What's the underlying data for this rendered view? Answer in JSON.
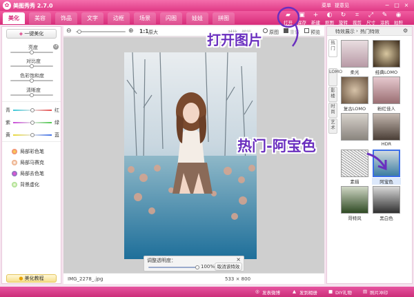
{
  "app": {
    "title": "美图秀秀 2.7.0"
  },
  "top_links": [
    "菜单",
    "提意见"
  ],
  "tabs": [
    "美化",
    "美容",
    "饰品",
    "文字",
    "边框",
    "场景",
    "闪图",
    "娃娃",
    "拼图"
  ],
  "tools": [
    "打开",
    "保存",
    "新建",
    "抠图",
    "旋转",
    "裁剪",
    "尺寸",
    "涂鸦",
    "拍照"
  ],
  "left": {
    "one_key": "一键美化",
    "adjust": [
      "亮度",
      "对比度",
      "色彩饱和度",
      "清晰度"
    ],
    "color_balance": {
      "cyan": "青",
      "red": "红",
      "magenta": "紫",
      "green": "绿",
      "yellow": "黄",
      "blue": "蓝"
    },
    "tools": [
      "局部彩色笔",
      "局部马赛克",
      "局部去色笔",
      "背景虚化"
    ],
    "tutorial": "美化教程"
  },
  "center": {
    "zoom_scale": "1:1",
    "zoom_label": "原大",
    "compare_label": "对比",
    "undo_label": "撤销",
    "original_label": "原图",
    "redo_label": "重做",
    "preview_label": "预览",
    "filename": "IMG_2278_.jpg",
    "dimensions": "533 × 800",
    "opacity_title": "调整透明度：",
    "opacity_value": "100%",
    "cancel_effect": "取消该特效"
  },
  "right": {
    "breadcrumb": [
      "特效展示",
      "热门特效"
    ],
    "vtabs": [
      "热门",
      "LOMO",
      "影楼",
      "时尚",
      "艺术"
    ],
    "effects": [
      "柔光",
      "经典LOMO",
      "复古LOMO",
      "粉红佳人",
      "",
      "HDR",
      "素描",
      "阿宝色",
      "哥特风",
      "黑白色"
    ]
  },
  "footer": [
    "发表微博",
    "发到相册",
    "DIY礼物",
    "照片冲印"
  ],
  "annotations": {
    "open": "打开图片",
    "hot": "热门-阿宝色"
  }
}
